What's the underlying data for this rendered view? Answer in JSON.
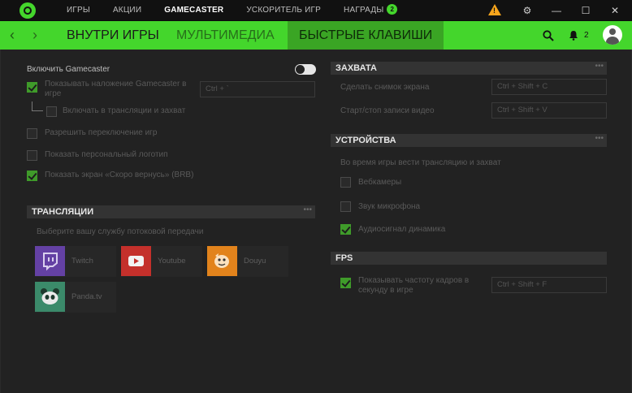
{
  "topnav": {
    "tabs": [
      "ИГРЫ",
      "АКЦИИ",
      "GAMECASTER",
      "УСКОРИТЕЛЬ ИГР",
      "НАГРАДЫ"
    ],
    "rewards_badge": "2",
    "window": {
      "settings": "⚙",
      "minimize": "—",
      "maximize": "☐",
      "close": "✕"
    }
  },
  "subnav": {
    "back": "‹",
    "forward": "›",
    "tabs": [
      "ВНУТРИ ИГРЫ",
      "МУЛЬТИМЕДИА",
      "БЫСТРЫЕ КЛАВИШИ"
    ],
    "notifications_count": "2"
  },
  "left": {
    "enable_label": "Включить Gamecaster",
    "overlay_label": "Показывать наложение Gamecaster в игре",
    "overlay_hotkey": "Ctrl + `",
    "include_label": "Включать в трансляции и захват",
    "allow_switch_label": "Разрешить переключение игр",
    "custom_logo_label": "Показать персональный логотип",
    "brb_label": "Показать экран «Скоро вернусь» (BRB)",
    "streams": {
      "title": "ТРАНСЛЯЦИИ",
      "hint": "Выберите вашу службу потоковой передачи",
      "services": [
        "Twitch",
        "Youtube",
        "Douyu",
        "Panda.tv"
      ]
    }
  },
  "right": {
    "capture": {
      "title": "ЗАХВАТА",
      "screenshot_label": "Сделать снимок экрана",
      "screenshot_hotkey": "Ctrl + Shift + C",
      "record_label": "Старт/стоп записи видео",
      "record_hotkey": "Ctrl + Shift + V"
    },
    "devices": {
      "title": "УСТРОЙСТВА",
      "hint": "Во время игры вести трансляцию и захват",
      "webcam": "Вебкамеры",
      "mic": "Звук микрофона",
      "audio": "Аудиосигнал динамика"
    },
    "fps": {
      "title": "FPS",
      "show_label_1": "Показывать частоту кадров в",
      "show_label_2": "секунду в игре",
      "hotkey": "Ctrl + Shift + F"
    }
  },
  "dots": "•••",
  "colors": {
    "accent": "#44d62c",
    "warning": "#f7a51c"
  }
}
